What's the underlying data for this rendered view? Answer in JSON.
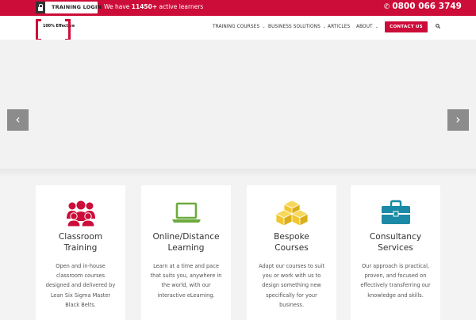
{
  "topbar": {
    "login_label": "TRAINING LOGIN",
    "learners_prefix": "We have ",
    "learners_count": "11450+",
    "learners_suffix": " active learners",
    "phone": "0800 066 3749"
  },
  "header": {
    "logo_text": "100% Effective",
    "nav": [
      {
        "label": "TRAINING COURSES",
        "has_dropdown": true
      },
      {
        "label": "BUSINESS SOLUTIONS",
        "has_dropdown": true
      },
      {
        "label": "ARTICLES",
        "has_dropdown": false
      },
      {
        "label": "ABOUT",
        "has_dropdown": true
      }
    ],
    "contact_label": "CONTACT US"
  },
  "hero": {
    "prev_glyph": "‹",
    "next_glyph": "›"
  },
  "colors": {
    "brand_red": "#cc0c39",
    "icon_red": "#cc0c39",
    "icon_green": "#6dab3c",
    "icon_yellow": "#f1c62f",
    "icon_teal": "#1a8aa6"
  },
  "cards": [
    {
      "icon": "classroom-people-icon",
      "title_line1": "Classroom",
      "title_line2": "Training",
      "text": [
        "Open and in-house",
        "classroom courses",
        "designed and delivered by",
        "Lean Six Sigma Master",
        "Black Belts."
      ]
    },
    {
      "icon": "laptop-icon",
      "title_line1": "Online/Distance",
      "title_line2": "Learning",
      "text": [
        "Learn at a time and pace",
        "that suits you, anywhere in",
        "the world, with our",
        "interactive eLearning."
      ]
    },
    {
      "icon": "boxes-icon",
      "title_line1": "Bespoke",
      "title_line2": "Courses",
      "text": [
        "Adapt our courses to suit",
        "you or work with us to",
        "design something new",
        "specifically for your",
        "business."
      ]
    },
    {
      "icon": "briefcase-icon",
      "title_line1": "Consultancy",
      "title_line2": "Services",
      "text": [
        "Our approach is practical,",
        "proven, and focused on",
        "effectively transferring our",
        "knowledge and skills."
      ]
    }
  ]
}
